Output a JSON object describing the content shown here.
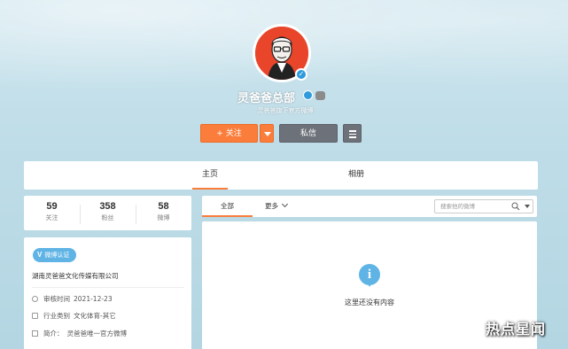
{
  "profile": {
    "nickname": "灵爸爸总部",
    "bio": "灵爸爸旗下官方微博",
    "follow_label": "+ 关注",
    "message_label": "私信"
  },
  "tabs": [
    {
      "label": "主页",
      "active": true
    },
    {
      "label": "相册",
      "active": false
    }
  ],
  "stats": [
    {
      "value": "59",
      "label": "关注"
    },
    {
      "value": "358",
      "label": "粉丝"
    },
    {
      "value": "58",
      "label": "微博"
    }
  ],
  "info": {
    "verify_badge": "V",
    "verify_label": "微博认证",
    "company": "湖南灵爸爸文化传媒有限公司",
    "review_time_label": "审核时间",
    "review_time": "2021-12-23",
    "category_label": "行业类别",
    "category": "文化体育-其它",
    "intro_label": "简介：",
    "intro": "灵爸爸唯一官方微博"
  },
  "feed": {
    "all_label": "全部",
    "more_label": "更多",
    "search_placeholder": "搜索他的微博",
    "empty_text": "这里还没有内容"
  },
  "watermark": "热点星闻",
  "colors": {
    "accent": "#fa7d3c",
    "verify_blue": "#5fb4e5",
    "message_gray": "#6c717a"
  }
}
